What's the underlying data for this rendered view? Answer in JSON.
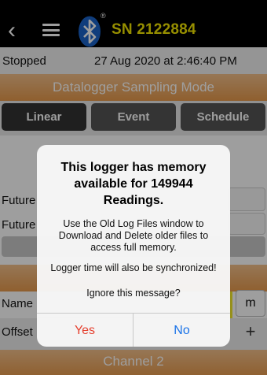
{
  "header": {
    "back_glyph": "‹",
    "registered_mark": "®",
    "serial": "SN 2122884"
  },
  "status": {
    "state": "Stopped",
    "datetime": "27 Aug 2020 at 2:46:40 PM"
  },
  "sections": {
    "sampling_mode_title": "Datalogger Sampling Mode",
    "channel_title": "Channel 2"
  },
  "modes": [
    {
      "label": "Linear",
      "active": true
    },
    {
      "label": "Event",
      "active": false
    },
    {
      "label": "Schedule",
      "active": false
    }
  ],
  "form": {
    "future_label_1": "Future",
    "future_label_2": "Future",
    "name_label": "Name",
    "offset_label": "Offset",
    "unit_value": "m",
    "offset_plus": "+"
  },
  "dialog": {
    "title": "This logger has memory available for 149944 Readings.",
    "message": "Use the Old Log Files window to Download and Delete older files to access full memory.",
    "sync_message": "Logger time will also be synchronized!",
    "question": "Ignore this message?",
    "yes_label": "Yes",
    "no_label": "No"
  },
  "colors": {
    "serial_yellow": "#f2e600",
    "orange_bar": "#e79a4c",
    "yes_red": "#e5402f",
    "no_blue": "#1a73e8"
  }
}
